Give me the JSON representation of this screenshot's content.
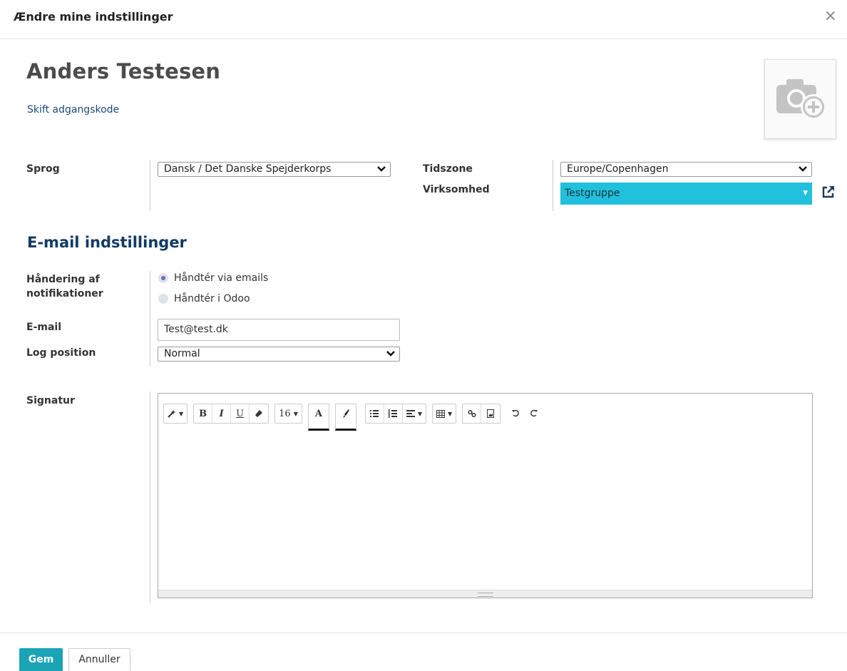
{
  "dialog": {
    "title": "Ændre mine indstillinger",
    "close_icon": "close-icon"
  },
  "user": {
    "name": "Anders Testesen",
    "change_password": "Skift adgangskode",
    "avatar_icon": "camera-plus-icon"
  },
  "fields": {
    "language": {
      "label": "Sprog",
      "value": "Dansk / Det Danske Spejderkorps"
    },
    "timezone": {
      "label": "Tidszone",
      "value": "Europe/Copenhagen"
    },
    "company": {
      "label": "Virksomhed",
      "value": "Testgruppe",
      "accent": "#21c0dc"
    }
  },
  "email_settings": {
    "heading": "E-mail indstillinger",
    "notification_label_line1": "Håndering af",
    "notification_label_line2": "notifikationer",
    "options": [
      {
        "label": "Håndtér via emails",
        "selected": true
      },
      {
        "label": "Håndtér i Odoo",
        "selected": false
      }
    ],
    "email_label": "E-mail",
    "email_value": "Test@test.dk",
    "log_label": "Log position",
    "log_value": "Normal",
    "signature_label": "Signatur"
  },
  "editor": {
    "font_size": "16",
    "bold": "B",
    "italic": "I",
    "underline": "U",
    "text_color": "A"
  },
  "footer": {
    "save": "Gem",
    "cancel": "Annuller",
    "primary_color": "#1ba3b6"
  }
}
